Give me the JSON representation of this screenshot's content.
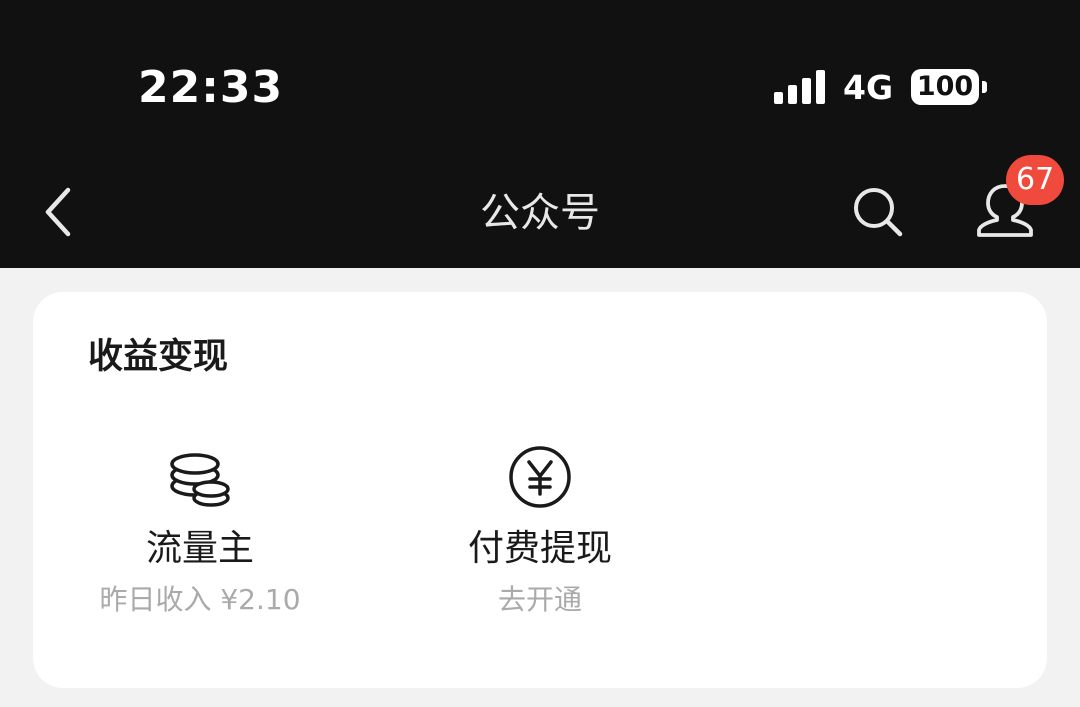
{
  "status_bar": {
    "time": "22:33",
    "network": "4G",
    "battery": "100"
  },
  "nav": {
    "title": "公众号",
    "badge_count": "67",
    "icons": [
      "back-chevron-icon",
      "search-icon",
      "profile-icon"
    ]
  },
  "card": {
    "title": "收益变现",
    "items": [
      {
        "icon": "coins-icon",
        "label": "流量主",
        "sub": "昨日收入 ¥2.10"
      },
      {
        "icon": "yuan-circle-icon",
        "label": "付费提现",
        "sub": "去开通"
      }
    ]
  },
  "colors": {
    "topbar": "#111111",
    "background": "#f2f2f2",
    "card": "#ffffff",
    "badge": "#f04a3c",
    "secondary_text": "#aaaaaa"
  }
}
